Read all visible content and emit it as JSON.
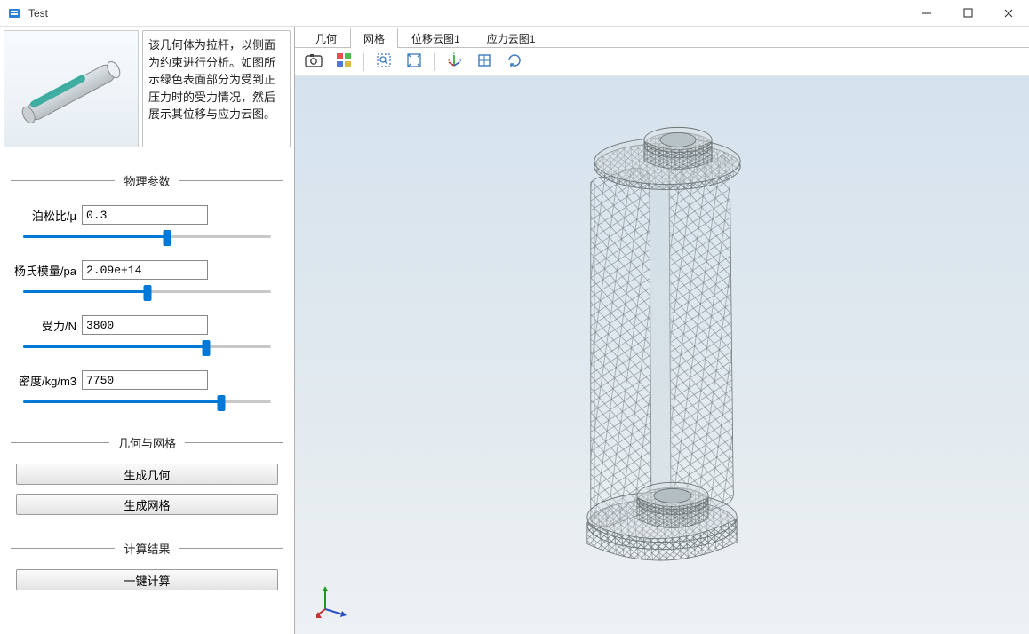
{
  "window": {
    "title": "Test",
    "icons": {
      "app": "app-icon",
      "minimize": "minimize-icon",
      "maximize": "maximize-icon",
      "close": "close-icon"
    }
  },
  "sidebar": {
    "description": "该几何体为拉杆，以侧面为约束进行分析。如图所示绿色表面部分为受到正压力时的受力情况，然后展示其位移与应力云图。",
    "sections": {
      "physical": {
        "legend": "物理参数"
      },
      "geom_mesh": {
        "legend": "几何与网格"
      },
      "results": {
        "legend": "计算结果"
      }
    },
    "params": {
      "poisson": {
        "label": "泊松比/μ",
        "value": "0.3",
        "pct": 58
      },
      "young": {
        "label": "杨氏模量/pa",
        "value": "2.09e+14",
        "pct": 50
      },
      "force": {
        "label": "受力/N",
        "value": "3800",
        "pct": 74
      },
      "density": {
        "label": "密度/kg/m3",
        "value": "7750",
        "pct": 80
      }
    },
    "buttons": {
      "gen_geom": "生成几何",
      "gen_mesh": "生成网格",
      "compute": "一键计算"
    }
  },
  "content": {
    "tabs": [
      {
        "id": "geom",
        "label": "几何",
        "active": false
      },
      {
        "id": "mesh",
        "label": "网格",
        "active": true
      },
      {
        "id": "disp1",
        "label": "位移云图1",
        "active": false
      },
      {
        "id": "stress1",
        "label": "应力云图1",
        "active": false
      }
    ],
    "toolbar": {
      "snapshot": "snapshot-icon",
      "layers": "layers-icon",
      "zoom_box": "zoom-box-icon",
      "zoom_fit": "zoom-extents-icon",
      "axes": "axes-icon",
      "reset": "reset-view-icon",
      "rotate": "rotate-icon"
    }
  }
}
